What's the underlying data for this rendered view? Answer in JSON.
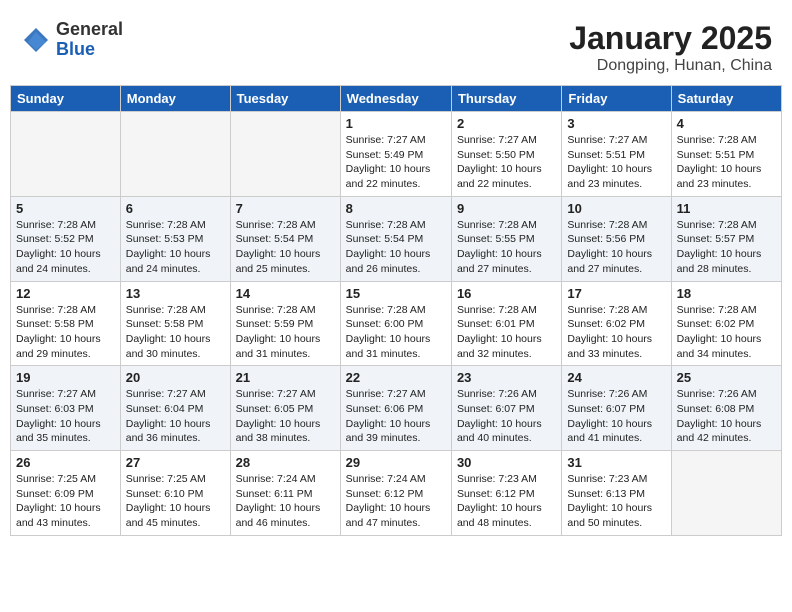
{
  "header": {
    "logo_general": "General",
    "logo_blue": "Blue",
    "month_title": "January 2025",
    "location": "Dongping, Hunan, China"
  },
  "weekdays": [
    "Sunday",
    "Monday",
    "Tuesday",
    "Wednesday",
    "Thursday",
    "Friday",
    "Saturday"
  ],
  "weeks": [
    [
      {
        "day": "",
        "info": ""
      },
      {
        "day": "",
        "info": ""
      },
      {
        "day": "",
        "info": ""
      },
      {
        "day": "1",
        "info": "Sunrise: 7:27 AM\nSunset: 5:49 PM\nDaylight: 10 hours and 22 minutes."
      },
      {
        "day": "2",
        "info": "Sunrise: 7:27 AM\nSunset: 5:50 PM\nDaylight: 10 hours and 22 minutes."
      },
      {
        "day": "3",
        "info": "Sunrise: 7:27 AM\nSunset: 5:51 PM\nDaylight: 10 hours and 23 minutes."
      },
      {
        "day": "4",
        "info": "Sunrise: 7:28 AM\nSunset: 5:51 PM\nDaylight: 10 hours and 23 minutes."
      }
    ],
    [
      {
        "day": "5",
        "info": "Sunrise: 7:28 AM\nSunset: 5:52 PM\nDaylight: 10 hours and 24 minutes."
      },
      {
        "day": "6",
        "info": "Sunrise: 7:28 AM\nSunset: 5:53 PM\nDaylight: 10 hours and 24 minutes."
      },
      {
        "day": "7",
        "info": "Sunrise: 7:28 AM\nSunset: 5:54 PM\nDaylight: 10 hours and 25 minutes."
      },
      {
        "day": "8",
        "info": "Sunrise: 7:28 AM\nSunset: 5:54 PM\nDaylight: 10 hours and 26 minutes."
      },
      {
        "day": "9",
        "info": "Sunrise: 7:28 AM\nSunset: 5:55 PM\nDaylight: 10 hours and 27 minutes."
      },
      {
        "day": "10",
        "info": "Sunrise: 7:28 AM\nSunset: 5:56 PM\nDaylight: 10 hours and 27 minutes."
      },
      {
        "day": "11",
        "info": "Sunrise: 7:28 AM\nSunset: 5:57 PM\nDaylight: 10 hours and 28 minutes."
      }
    ],
    [
      {
        "day": "12",
        "info": "Sunrise: 7:28 AM\nSunset: 5:58 PM\nDaylight: 10 hours and 29 minutes."
      },
      {
        "day": "13",
        "info": "Sunrise: 7:28 AM\nSunset: 5:58 PM\nDaylight: 10 hours and 30 minutes."
      },
      {
        "day": "14",
        "info": "Sunrise: 7:28 AM\nSunset: 5:59 PM\nDaylight: 10 hours and 31 minutes."
      },
      {
        "day": "15",
        "info": "Sunrise: 7:28 AM\nSunset: 6:00 PM\nDaylight: 10 hours and 31 minutes."
      },
      {
        "day": "16",
        "info": "Sunrise: 7:28 AM\nSunset: 6:01 PM\nDaylight: 10 hours and 32 minutes."
      },
      {
        "day": "17",
        "info": "Sunrise: 7:28 AM\nSunset: 6:02 PM\nDaylight: 10 hours and 33 minutes."
      },
      {
        "day": "18",
        "info": "Sunrise: 7:28 AM\nSunset: 6:02 PM\nDaylight: 10 hours and 34 minutes."
      }
    ],
    [
      {
        "day": "19",
        "info": "Sunrise: 7:27 AM\nSunset: 6:03 PM\nDaylight: 10 hours and 35 minutes."
      },
      {
        "day": "20",
        "info": "Sunrise: 7:27 AM\nSunset: 6:04 PM\nDaylight: 10 hours and 36 minutes."
      },
      {
        "day": "21",
        "info": "Sunrise: 7:27 AM\nSunset: 6:05 PM\nDaylight: 10 hours and 38 minutes."
      },
      {
        "day": "22",
        "info": "Sunrise: 7:27 AM\nSunset: 6:06 PM\nDaylight: 10 hours and 39 minutes."
      },
      {
        "day": "23",
        "info": "Sunrise: 7:26 AM\nSunset: 6:07 PM\nDaylight: 10 hours and 40 minutes."
      },
      {
        "day": "24",
        "info": "Sunrise: 7:26 AM\nSunset: 6:07 PM\nDaylight: 10 hours and 41 minutes."
      },
      {
        "day": "25",
        "info": "Sunrise: 7:26 AM\nSunset: 6:08 PM\nDaylight: 10 hours and 42 minutes."
      }
    ],
    [
      {
        "day": "26",
        "info": "Sunrise: 7:25 AM\nSunset: 6:09 PM\nDaylight: 10 hours and 43 minutes."
      },
      {
        "day": "27",
        "info": "Sunrise: 7:25 AM\nSunset: 6:10 PM\nDaylight: 10 hours and 45 minutes."
      },
      {
        "day": "28",
        "info": "Sunrise: 7:24 AM\nSunset: 6:11 PM\nDaylight: 10 hours and 46 minutes."
      },
      {
        "day": "29",
        "info": "Sunrise: 7:24 AM\nSunset: 6:12 PM\nDaylight: 10 hours and 47 minutes."
      },
      {
        "day": "30",
        "info": "Sunrise: 7:23 AM\nSunset: 6:12 PM\nDaylight: 10 hours and 48 minutes."
      },
      {
        "day": "31",
        "info": "Sunrise: 7:23 AM\nSunset: 6:13 PM\nDaylight: 10 hours and 50 minutes."
      },
      {
        "day": "",
        "info": ""
      }
    ]
  ]
}
